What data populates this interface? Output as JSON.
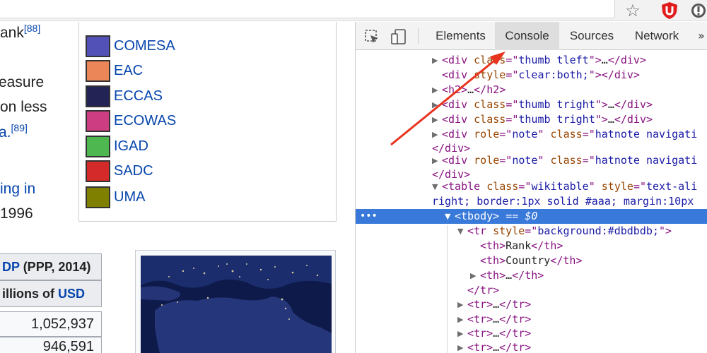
{
  "page": {
    "text_lines": [
      {
        "text": "ank",
        "suffix": "[88]",
        "link": false
      },
      {
        "text": "easure",
        "link": false
      },
      {
        "text": " on less",
        "link": false
      },
      {
        "text": "a.",
        "suffix": "[89]",
        "link": true
      },
      {
        "text": "ing in",
        "link": true
      },
      {
        "text": "1996",
        "link": false
      }
    ],
    "legend": [
      {
        "label": "COMESA",
        "color": "#5151b8"
      },
      {
        "label": "EAC",
        "color": "#ea8657"
      },
      {
        "label": "ECCAS",
        "color": "#232355"
      },
      {
        "label": "ECOWAS",
        "color": "#cd3d82"
      },
      {
        "label": "IGAD",
        "color": "#4fb74f"
      },
      {
        "label": "SADC",
        "color": "#d52a2a"
      },
      {
        "label": "UMA",
        "color": "#808000"
      }
    ],
    "gdp": {
      "head1_link": "DP",
      "head1_text": " (PPP, 2014)",
      "head2_text": "illions of ",
      "head2_link": "USD",
      "values": [
        "1,052,937",
        "946,591"
      ]
    }
  },
  "devtools": {
    "tabs": [
      "Elements",
      "Console",
      "Sources",
      "Network"
    ],
    "active_tab": "Console",
    "more": "»",
    "dom": [
      {
        "indent": 0,
        "tri": "right",
        "parts": [
          [
            "t",
            "<div "
          ],
          [
            "an",
            "class"
          ],
          [
            "t",
            "=\""
          ],
          [
            "av",
            "thumb tleft"
          ],
          [
            "t",
            "\">"
          ],
          [
            "ell",
            "…"
          ],
          [
            "t",
            "</div>"
          ]
        ]
      },
      {
        "indent": 0,
        "tri": "none",
        "parts": [
          [
            "t",
            "<div "
          ],
          [
            "an",
            "style"
          ],
          [
            "t",
            "=\""
          ],
          [
            "av",
            "clear:both;"
          ],
          [
            "t",
            "\"></div>"
          ]
        ]
      },
      {
        "indent": 0,
        "tri": "right",
        "parts": [
          [
            "t",
            "<h2>"
          ],
          [
            "ell",
            "…"
          ],
          [
            "t",
            "</h2>"
          ]
        ]
      },
      {
        "indent": 0,
        "tri": "right",
        "parts": [
          [
            "t",
            "<div "
          ],
          [
            "an",
            "class"
          ],
          [
            "t",
            "=\""
          ],
          [
            "av",
            "thumb tright"
          ],
          [
            "t",
            "\">"
          ],
          [
            "ell",
            "…"
          ],
          [
            "t",
            "</div>"
          ]
        ]
      },
      {
        "indent": 0,
        "tri": "right",
        "parts": [
          [
            "t",
            "<div "
          ],
          [
            "an",
            "class"
          ],
          [
            "t",
            "=\""
          ],
          [
            "av",
            "thumb tright"
          ],
          [
            "t",
            "\">"
          ],
          [
            "ell",
            "…"
          ],
          [
            "t",
            "</div>"
          ]
        ]
      },
      {
        "indent": 0,
        "tri": "right",
        "parts": [
          [
            "t",
            "<div "
          ],
          [
            "an",
            "role"
          ],
          [
            "t",
            "=\""
          ],
          [
            "av",
            "note"
          ],
          [
            "t",
            "\" "
          ],
          [
            "an",
            "class"
          ],
          [
            "t",
            "=\""
          ],
          [
            "av",
            "hatnote navigati"
          ]
        ]
      },
      {
        "indent": -1,
        "tri": "none",
        "parts": [
          [
            "t",
            "</div>"
          ]
        ]
      },
      {
        "indent": 0,
        "tri": "right",
        "parts": [
          [
            "t",
            "<div "
          ],
          [
            "an",
            "role"
          ],
          [
            "t",
            "=\""
          ],
          [
            "av",
            "note"
          ],
          [
            "t",
            "\" "
          ],
          [
            "an",
            "class"
          ],
          [
            "t",
            "=\""
          ],
          [
            "av",
            "hatnote navigati"
          ]
        ]
      },
      {
        "indent": -1,
        "tri": "none",
        "parts": [
          [
            "t",
            "</div>"
          ]
        ]
      },
      {
        "indent": 0,
        "tri": "down",
        "parts": [
          [
            "t",
            "<table "
          ],
          [
            "an",
            "class"
          ],
          [
            "t",
            "=\""
          ],
          [
            "av",
            "wikitable"
          ],
          [
            "t",
            "\" "
          ],
          [
            "an",
            "style"
          ],
          [
            "t",
            "=\""
          ],
          [
            "av",
            "text-ali"
          ]
        ]
      },
      {
        "indent": -1,
        "tri": "none",
        "parts": [
          [
            "av",
            "right; border:1px solid #aaa; margin:10px"
          ]
        ]
      },
      {
        "indent": 1,
        "tri": "down",
        "selected": true,
        "parts": [
          [
            "t",
            "<tbody>"
          ],
          [
            "sel",
            " == $0"
          ]
        ]
      },
      {
        "indent": 2,
        "tri": "down",
        "parts": [
          [
            "t",
            "<tr "
          ],
          [
            "an",
            "style"
          ],
          [
            "t",
            "=\""
          ],
          [
            "av",
            "background:#dbdbdb;"
          ],
          [
            "t",
            "\">"
          ]
        ]
      },
      {
        "indent": 3,
        "tri": "none",
        "parts": [
          [
            "t",
            "<th>"
          ],
          [
            "tx",
            "Rank"
          ],
          [
            "t",
            "</th>"
          ]
        ]
      },
      {
        "indent": 3,
        "tri": "none",
        "parts": [
          [
            "t",
            "<th>"
          ],
          [
            "tx",
            "Country"
          ],
          [
            "t",
            "</th>"
          ]
        ]
      },
      {
        "indent": 3,
        "tri": "right",
        "parts": [
          [
            "t",
            "<th>"
          ],
          [
            "ell",
            "…"
          ],
          [
            "t",
            "</th>"
          ]
        ]
      },
      {
        "indent": 2,
        "tri": "none",
        "parts": [
          [
            "t",
            "</tr>"
          ]
        ]
      },
      {
        "indent": 2,
        "tri": "right",
        "parts": [
          [
            "t",
            "<tr>"
          ],
          [
            "ell",
            "…"
          ],
          [
            "t",
            "</tr>"
          ]
        ]
      },
      {
        "indent": 2,
        "tri": "right",
        "parts": [
          [
            "t",
            "<tr>"
          ],
          [
            "ell",
            "…"
          ],
          [
            "t",
            "</tr>"
          ]
        ]
      },
      {
        "indent": 2,
        "tri": "right",
        "parts": [
          [
            "t",
            "<tr>"
          ],
          [
            "ell",
            "…"
          ],
          [
            "t",
            "</tr>"
          ]
        ]
      },
      {
        "indent": 2,
        "tri": "right",
        "parts": [
          [
            "t",
            "<tr>"
          ],
          [
            "ell",
            "…"
          ],
          [
            "t",
            "</tr>"
          ]
        ]
      }
    ],
    "selected_dots": "•••"
  },
  "colors": {
    "selection": "#3879d9",
    "annotation_arrow": "#e8331f",
    "link": "#0645ad"
  },
  "icons": [
    "star-icon",
    "ublock-icon",
    "extension-icon",
    "inspect-element-icon",
    "device-toolbar-icon"
  ]
}
